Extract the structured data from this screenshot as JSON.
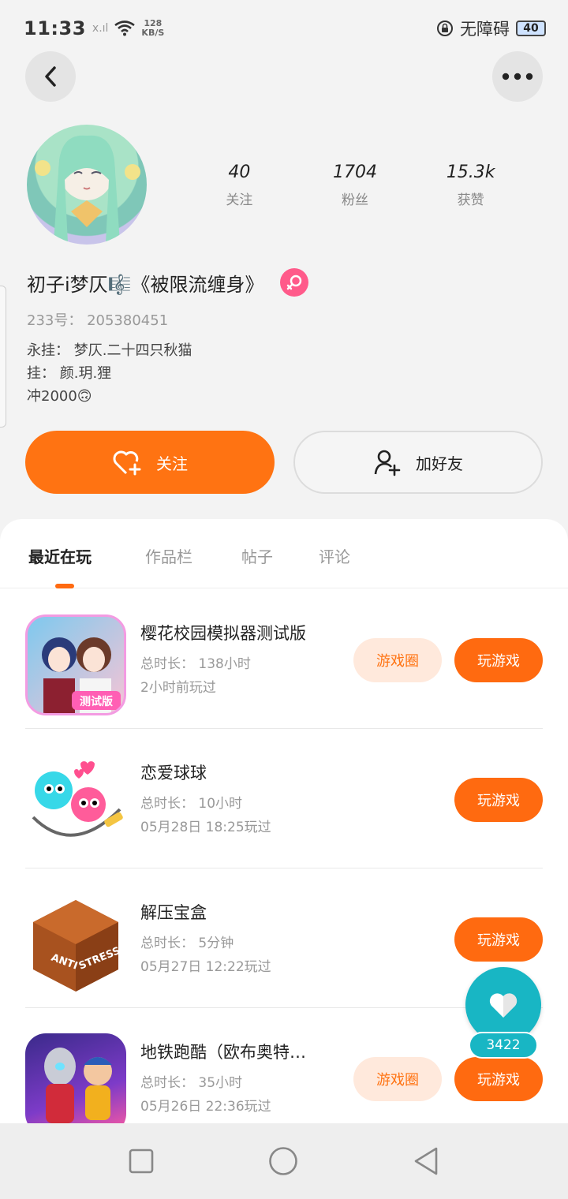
{
  "status_bar": {
    "time": "11:33",
    "signal": "x.ıl",
    "speed_value": "128",
    "speed_unit": "KB/S",
    "accessibility_label": "无障碍",
    "battery": "40"
  },
  "profile": {
    "stats": [
      {
        "value": "40",
        "label": "关注"
      },
      {
        "value": "1704",
        "label": "粉丝"
      },
      {
        "value": "15.3k",
        "label": "获赞"
      }
    ],
    "username": "初子i梦仄🎼《被限流缠身》",
    "uid": "233号：  205380451",
    "bio_lines": [
      "永挂：  梦仄.二十四只秋猫",
      "挂：  颜.玥.狸",
      "冲2000🙃"
    ],
    "follow_label": "关注",
    "add_friend_label": "加好友"
  },
  "tabs": [
    "最近在玩",
    "作品栏",
    "帖子",
    "评论"
  ],
  "games": [
    {
      "name": "樱花校园模拟器测试版",
      "duration": "总时长：  138小时",
      "last_played": "2小时前玩过",
      "circle_label": "游戏圈",
      "play_label": "玩游戏",
      "icon_badge": "测试版"
    },
    {
      "name": "恋爱球球",
      "duration": "总时长：  10小时",
      "last_played": "05月28日  18:25玩过",
      "play_label": "玩游戏"
    },
    {
      "name": "解压宝盒",
      "duration": "总时长：  5分钟",
      "last_played": "05月27日  12:22玩过",
      "play_label": "玩游戏",
      "icon_text_1": "ANTI",
      "icon_text_2": "STRESS"
    },
    {
      "name": "地铁跑酷（欧布奥特…",
      "duration": "总时长：  35小时",
      "last_played": "05月26日  22:36玩过",
      "circle_label": "游戏圈",
      "play_label": "玩游戏"
    }
  ],
  "floating_like": {
    "count": "3422"
  },
  "colors": {
    "accent": "#ff7312",
    "like": "#18b6c4",
    "gender": "#ff5a8a"
  }
}
